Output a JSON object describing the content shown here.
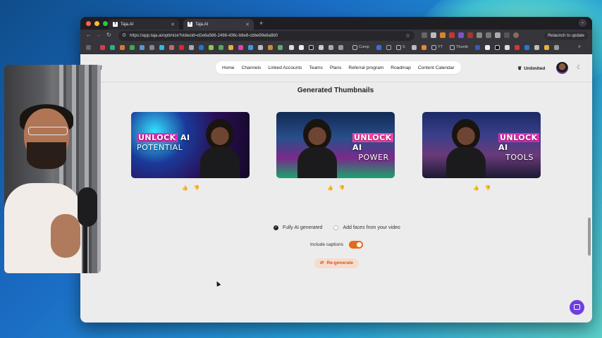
{
  "browser": {
    "tabs": [
      {
        "label": "Taja.AI",
        "favicon": "T"
      },
      {
        "label": "Taja.AI",
        "favicon": "T"
      }
    ],
    "url": "https://app.taja.ai/optimize?videoId=d2e6a566-2498-436c-b6e8-cbbe99e8a8b0",
    "relaunch_label": "Relaunch to update",
    "bookmarks": [
      "Comp",
      "S",
      "YT",
      "Thumb"
    ]
  },
  "app": {
    "nav_items": [
      "Home",
      "Channels",
      "Linked Accounts",
      "Teams",
      "Plans",
      "Referral program",
      "Roadmap",
      "Content Calendar"
    ],
    "plan_label": "Unlimited",
    "section_title": "Generated Thumbnails",
    "thumbnails": [
      {
        "word1": "UNLOCK",
        "word2": "AI",
        "word3": "POTENTIAL"
      },
      {
        "word1": "UNLOCK",
        "word2": "AI",
        "word3": "POWER"
      },
      {
        "word1": "UNLOCK",
        "word2": "AI",
        "word3": "TOOLS"
      }
    ],
    "options": {
      "fully_ai": "Fully AI generated",
      "add_faces": "Add faces from your video",
      "selected": "fully_ai"
    },
    "captions_label": "Include captions",
    "captions_on": true,
    "regenerate_label": "Re-generate"
  },
  "colors": {
    "accent_orange": "#e8681c",
    "chat_purple": "#6d3fe0",
    "caption_highlight": "#e12bb5"
  },
  "icons": [
    "menu-icon",
    "back-icon",
    "forward-icon",
    "reload-icon",
    "star-icon",
    "crown-icon",
    "moon-icon",
    "thumbs-up-icon",
    "thumbs-down-icon",
    "regenerate-icon",
    "chat-icon"
  ]
}
